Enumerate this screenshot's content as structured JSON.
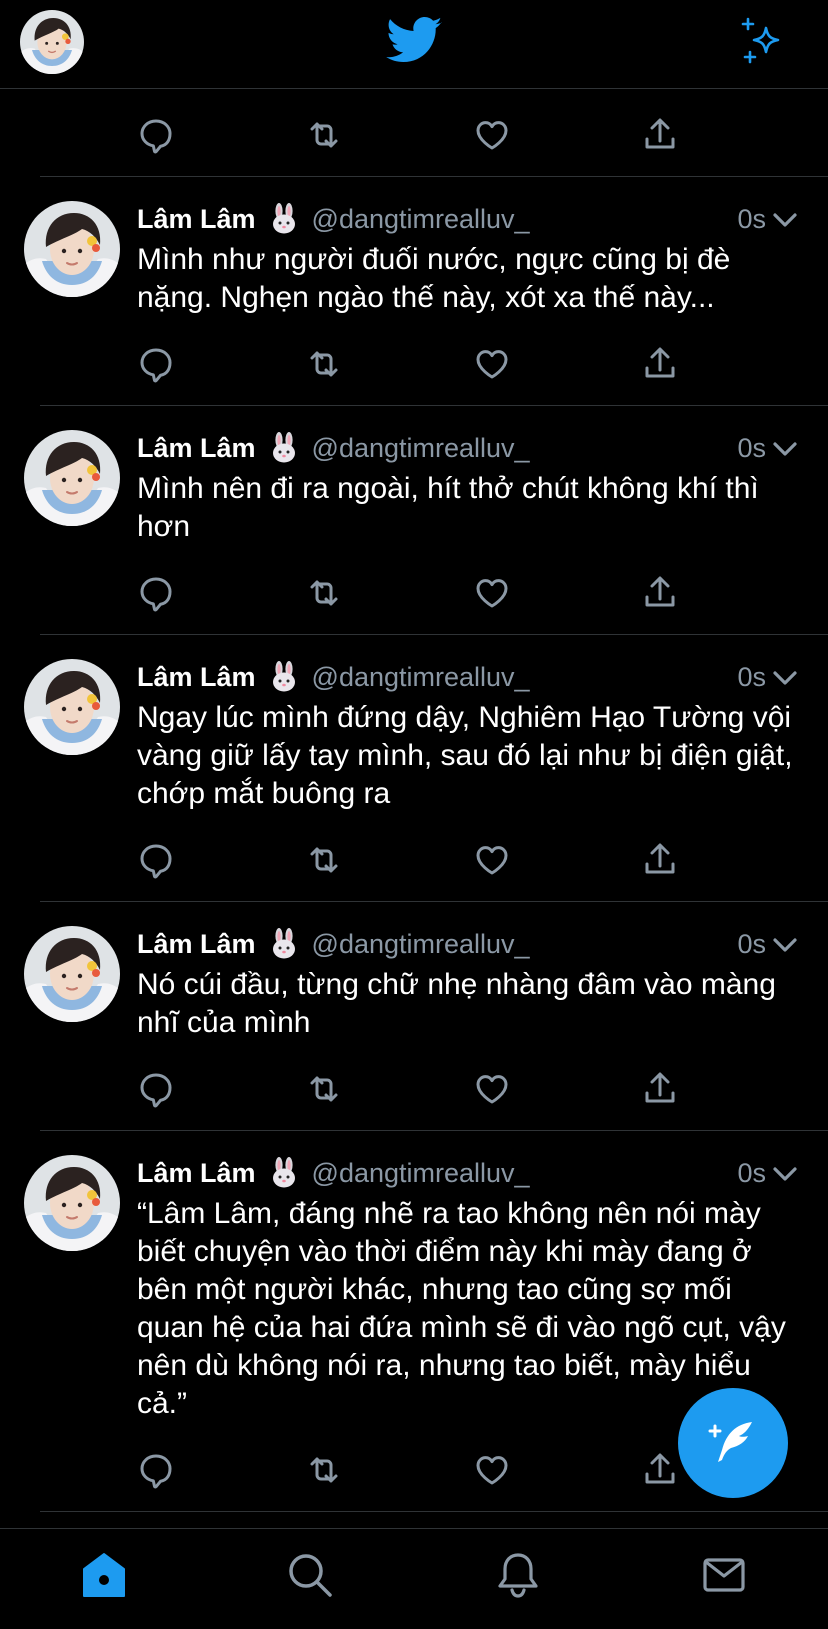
{
  "colors": {
    "accent": "#1d9bf0",
    "muted": "#8b98a5",
    "background": "#000000",
    "divider": "#2f3336"
  },
  "header": {
    "left": "profile-avatar",
    "center": "twitter-bird-logo",
    "right": "sparkle-icon"
  },
  "tweets": [
    {
      "name": "Lâm Lâm",
      "emoji": "rabbit-face",
      "handle": "@dangtimrealluv_",
      "time": "0s",
      "text": "Mình như người đuối nước, ngực cũng bị đè nặng. Nghẹn ngào thế này, xót xa thế này..."
    },
    {
      "name": "Lâm Lâm",
      "emoji": "rabbit-face",
      "handle": "@dangtimrealluv_",
      "time": "0s",
      "text": "Mình nên đi ra ngoài, hít thở chút không khí thì hơn"
    },
    {
      "name": "Lâm Lâm",
      "emoji": "rabbit-face",
      "handle": "@dangtimrealluv_",
      "time": "0s",
      "text": "Ngay lúc mình đứng dậy, Nghiêm Hạo Tường vội vàng giữ lấy tay mình, sau đó lại như bị điện giật, chớp mắt buông ra"
    },
    {
      "name": "Lâm Lâm",
      "emoji": "rabbit-face",
      "handle": "@dangtimrealluv_",
      "time": "0s",
      "text": "Nó cúi đầu, từng chữ nhẹ nhàng đâm vào màng nhĩ của mình"
    },
    {
      "name": "Lâm Lâm",
      "emoji": "rabbit-face",
      "handle": "@dangtimrealluv_",
      "time": "0s",
      "text": "“Lâm Lâm, đáng nhẽ ra tao không nên nói mày biết chuyện vào thời điểm này khi mày đang ở bên một người khác, nhưng tao cũng sợ mối quan hệ của hai đứa mình sẽ đi vào ngõ cụt, vậy nên dù không nói ra, nhưng tao biết, mày hiểu cả.”"
    }
  ],
  "actions": [
    "reply-icon",
    "retweet-icon",
    "like-icon",
    "share-icon"
  ],
  "fab": {
    "icon": "compose-tweet-icon"
  },
  "tabbar": {
    "items": [
      "home-icon",
      "search-icon",
      "notifications-icon",
      "messages-icon"
    ],
    "active": "home-icon"
  }
}
